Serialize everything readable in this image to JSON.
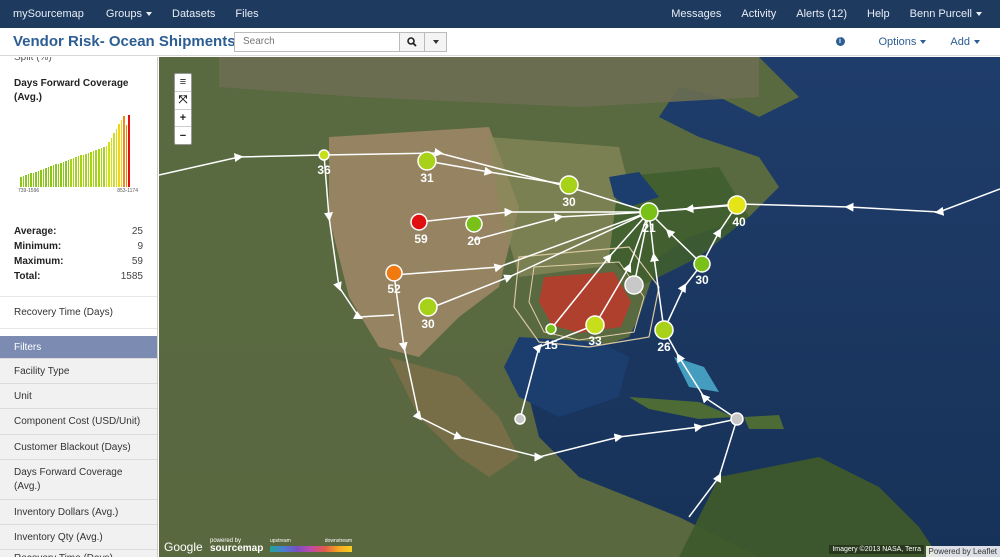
{
  "nav": {
    "brand": "mySourcemap",
    "groups": "Groups",
    "datasets": "Datasets",
    "files": "Files",
    "messages": "Messages",
    "activity": "Activity",
    "alerts": "Alerts (12)",
    "help": "Help",
    "user": "Benn Purcell"
  },
  "header": {
    "title": "Vendor Risk- Ocean Shipments",
    "search_placeholder": "Search",
    "info_icon": "i",
    "options": "Options",
    "add": "Add"
  },
  "sidebar": {
    "cut_top": "Split (%)",
    "metric_title": "Days Forward Coverage (Avg.)",
    "histo_min_label": "739-1596",
    "histo_max_label": "853-1174",
    "stats": [
      {
        "label": "Average:",
        "value": "25"
      },
      {
        "label": "Minimum:",
        "value": "9"
      },
      {
        "label": "Maximum:",
        "value": "59"
      },
      {
        "label": "Total:",
        "value": "1585"
      }
    ],
    "recovery": "Recovery Time (Days)",
    "filters_header": "Filters",
    "filters": [
      "Facility Type",
      "Unit",
      "Component Cost (USD/Unit)",
      "Customer Blackout (Days)",
      "Days Forward Coverage (Avg.)",
      "Inventory Dollars (Avg.)",
      "Inventory Qty (Avg.)",
      "Recovery Time (Days)"
    ]
  },
  "map": {
    "zoom_controls": [
      "≡",
      "⤧",
      "+",
      "−"
    ],
    "google": "Google",
    "powered_by": "powered by",
    "sourcemap": "sourcemap",
    "legend_upstream": "upstream",
    "legend_downstream": "downstream",
    "attribution": "Imagery ©2013 NASA, Terra",
    "leaflet": "Powered by Leaflet",
    "node_labels": [
      "36",
      "31",
      "30",
      "59",
      "20",
      "21",
      "40",
      "52",
      "30",
      "30",
      "15",
      "33",
      "26"
    ]
  },
  "colors": {
    "nav_bg": "#1e3a5f",
    "title": "#2c5d93",
    "filters_header": "#7b8bb2",
    "node_red": "#e01010",
    "node_orange": "#f07a10",
    "node_yellow": "#e4e417",
    "node_green": "#79c119"
  }
}
